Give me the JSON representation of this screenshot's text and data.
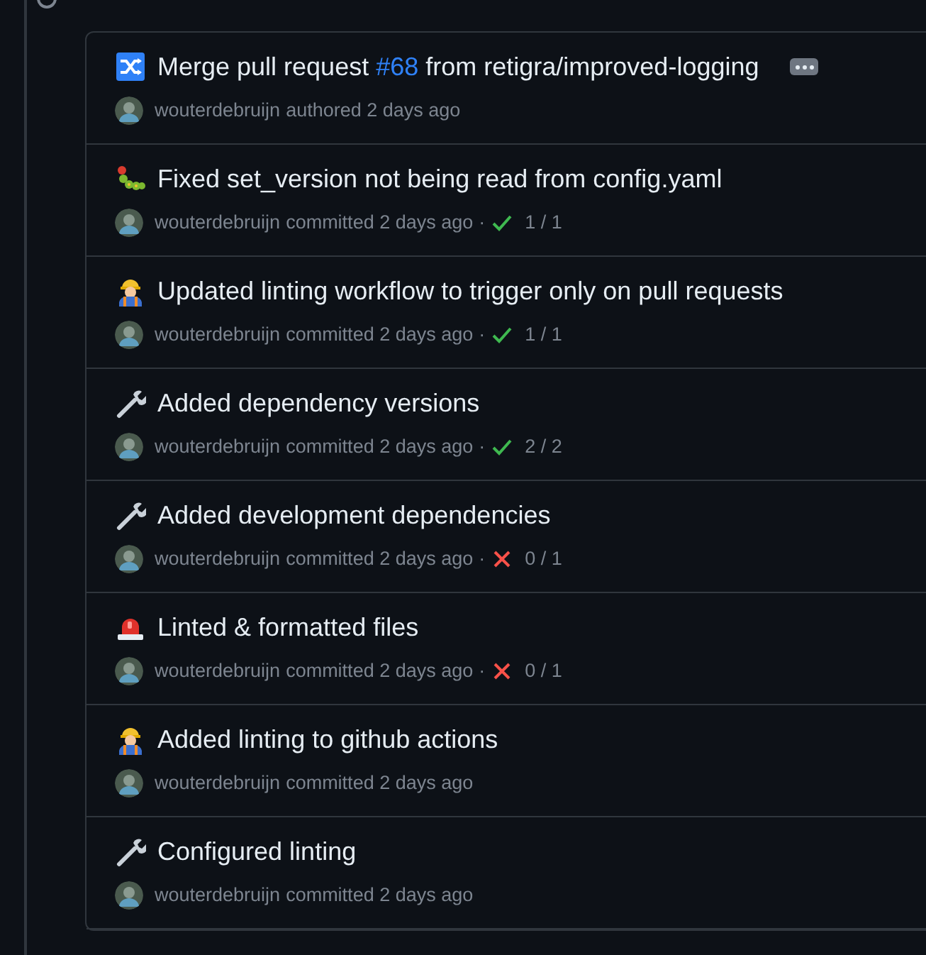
{
  "commits": [
    {
      "kind": "merge",
      "title": "Merge pull request ",
      "link": "#68",
      "title_after": " from retigra/improved-logging",
      "has_more": true,
      "author": "wouterdebruijn",
      "verb": "authored",
      "time": "2 days ago"
    },
    {
      "kind": "caterpillar",
      "title": "Fixed set_version not being read from config.yaml",
      "author": "wouterdebruijn",
      "verb": "committed",
      "time": "2 days ago",
      "checks": {
        "separator": "·",
        "passed": true,
        "count": "1 / 1"
      }
    },
    {
      "kind": "worker",
      "title": "Updated linting workflow to trigger only on pull requests",
      "author": "wouterdebruijn",
      "verb": "committed",
      "time": "2 days ago",
      "checks": {
        "separator": "·",
        "passed": true,
        "count": "1 / 1"
      }
    },
    {
      "kind": "wrench",
      "title": "Added dependency versions",
      "author": "wouterdebruijn",
      "verb": "committed",
      "time": "2 days ago",
      "checks": {
        "separator": "·",
        "passed": true,
        "count": "2 / 2"
      }
    },
    {
      "kind": "wrench",
      "title": "Added development dependencies",
      "author": "wouterdebruijn",
      "verb": "committed",
      "time": "2 days ago",
      "checks": {
        "separator": "·",
        "passed": false,
        "count": "0 / 1"
      }
    },
    {
      "kind": "siren",
      "title": "Linted & formatted files",
      "author": "wouterdebruijn",
      "verb": "committed",
      "time": "2 days ago",
      "checks": {
        "separator": "·",
        "passed": false,
        "count": "0 / 1"
      }
    },
    {
      "kind": "worker",
      "title": "Added linting to github actions",
      "author": "wouterdebruijn",
      "verb": "committed",
      "time": "2 days ago"
    },
    {
      "kind": "wrench",
      "title": "Configured linting",
      "author": "wouterdebruijn",
      "verb": "committed",
      "time": "2 days ago"
    }
  ]
}
